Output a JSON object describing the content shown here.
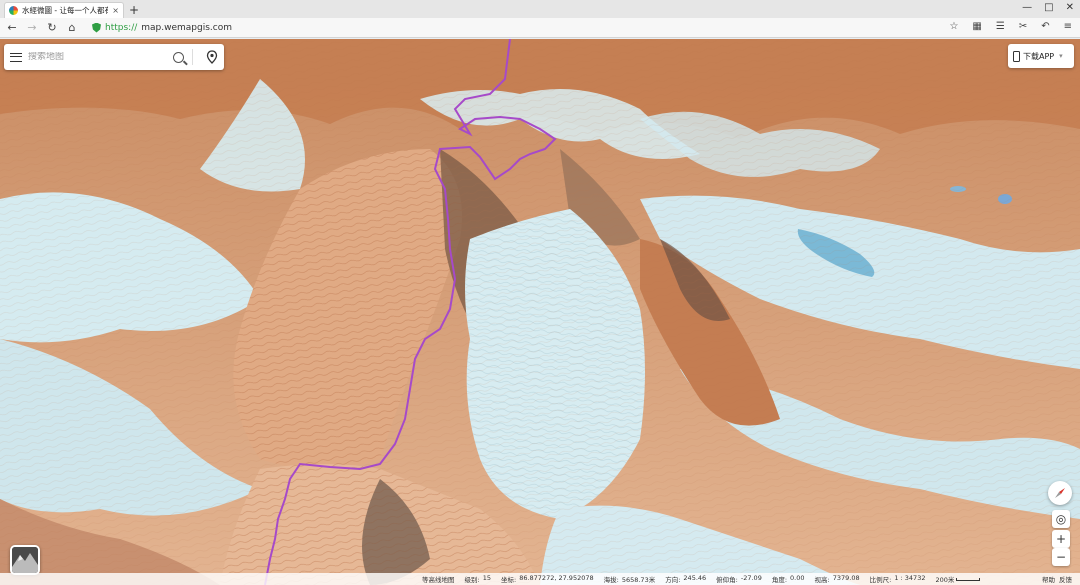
{
  "browser": {
    "tab_title": "水經微圖 - 让每一个人都有主",
    "tab_close": "×",
    "new_tab": "+",
    "url_scheme": "https://",
    "url_host": "map.wemapgis.com",
    "window_controls": [
      "—",
      "□",
      "✕"
    ],
    "toolbar_icons": [
      "star-icon",
      "grid-icon",
      "favorites-icon",
      "cut-icon",
      "undo-icon",
      "menu-icon"
    ],
    "toolbar_glyphs": [
      "☆",
      "▦",
      "☰",
      "✂",
      "↶",
      "≡"
    ]
  },
  "search": {
    "placeholder": "搜索地图"
  },
  "download": {
    "label": "下载APP"
  },
  "controls": {
    "locate": "◎",
    "zoom_in": "+",
    "zoom_out": "−"
  },
  "status": {
    "layer_label": "等高线地图",
    "level_label": "级别:",
    "level_value": "15",
    "coord_label": "坐标:",
    "coord_value": "86.877272, 27.952078",
    "elev_label": "海拔:",
    "elev_value": "5658.73米",
    "heading_label": "方向:",
    "heading_value": "245.46",
    "pitch_label": "俯仰角:",
    "pitch_value": "-27.09",
    "tilt_label": "角度:",
    "tilt_value": "0.00",
    "view_label": "视高:",
    "view_value": "7379.08",
    "ratio_label": "比例尺:",
    "ratio_value": "1 : 34732",
    "scale_label": "200米",
    "links": [
      "帮助",
      "反馈"
    ]
  },
  "colors": {
    "route": "#a64ac9",
    "rock": "#c9855a",
    "snow": "#cfe8ee",
    "lake": "#7bb9d6",
    "accent_green": "#2f9e44"
  }
}
